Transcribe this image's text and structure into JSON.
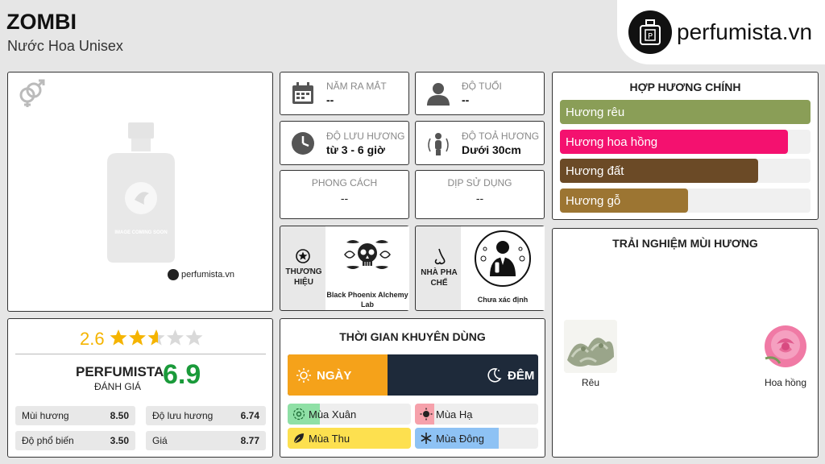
{
  "header": {
    "title": "ZOMBI",
    "subtitle": "Nước Hoa Unisex"
  },
  "logo": {
    "text": "perfumista.vn"
  },
  "product_image": {
    "placeholder_text": "IMAGE COMING SOON",
    "watermark": "perfumista.vn",
    "gender_icon": "unisex-gender-icon"
  },
  "info": {
    "release_year": {
      "label": "NĂM RA MẮT",
      "value": "--"
    },
    "age": {
      "label": "ĐỘ TUỔI",
      "value": "--"
    },
    "longevity": {
      "label": "ĐỘ LƯU HƯƠNG",
      "value": "từ 3 - 6 giờ"
    },
    "sillage": {
      "label": "ĐỘ TOẢ HƯƠNG",
      "value": "Dưới 30cm"
    },
    "style": {
      "label": "PHONG CÁCH",
      "value": "--"
    },
    "occasion": {
      "label": "DỊP SỬ DỤNG",
      "value": "--"
    },
    "brand": {
      "label_line1": "THƯƠNG",
      "label_line2": "HIỆU",
      "name_line1": "Black Phoenix Alchemy",
      "name_line2": "Lab"
    },
    "perfumer": {
      "label_line1": "NHÀ PHA",
      "label_line2": "CHẾ",
      "name": "Chưa xác định"
    }
  },
  "accords": {
    "title": "HỢP HƯƠNG CHÍNH",
    "items": [
      {
        "label": "Hương rêu",
        "percent": 100,
        "color": "#8a9e57"
      },
      {
        "label": "Hương hoa hồng",
        "percent": 91,
        "color": "#f4116f"
      },
      {
        "label": "Hương đất",
        "percent": 79,
        "color": "#6b4a26"
      },
      {
        "label": "Hương gỗ",
        "percent": 51,
        "color": "#9c7532"
      }
    ]
  },
  "experience": {
    "title": "TRẢI NGHIỆM MÙI HƯƠNG",
    "notes": [
      {
        "label": "Rêu"
      },
      {
        "label": "Hoa hồng"
      }
    ]
  },
  "rating": {
    "score": "2.6",
    "stars": 2.6,
    "perfumista_label": "PERFUMISTA",
    "perfumista_sub": "ĐÁNH GIÁ",
    "perfumista_score": "6.9",
    "stats": [
      {
        "label": "Mùi hương",
        "value": "8.50"
      },
      {
        "label": "Độ lưu hương",
        "value": "6.74"
      },
      {
        "label": "Độ phổ biến",
        "value": "3.50"
      },
      {
        "label": "Giá",
        "value": "8.77"
      }
    ]
  },
  "time": {
    "title": "THỜI GIAN KHUYÊN DÙNG",
    "day_label": "NGÀY",
    "night_label": "ĐÊM",
    "day_fraction": 0.4,
    "seasons": [
      {
        "label": "Mùa Xuân",
        "fill": 0.26,
        "color": "#8fe0a6"
      },
      {
        "label": "Mùa Hạ",
        "fill": 0.16,
        "color": "#f6a1ab"
      },
      {
        "label": "Mùa Thu",
        "fill": 1.0,
        "color": "#fde04f"
      },
      {
        "label": "Mùa Đông",
        "fill": 0.68,
        "color": "#8ec2f4"
      }
    ]
  },
  "colors": {
    "accent_green": "#1a9a3a",
    "star": "#f5b400",
    "day": "#f5a21a",
    "night": "#1e2a3a"
  }
}
